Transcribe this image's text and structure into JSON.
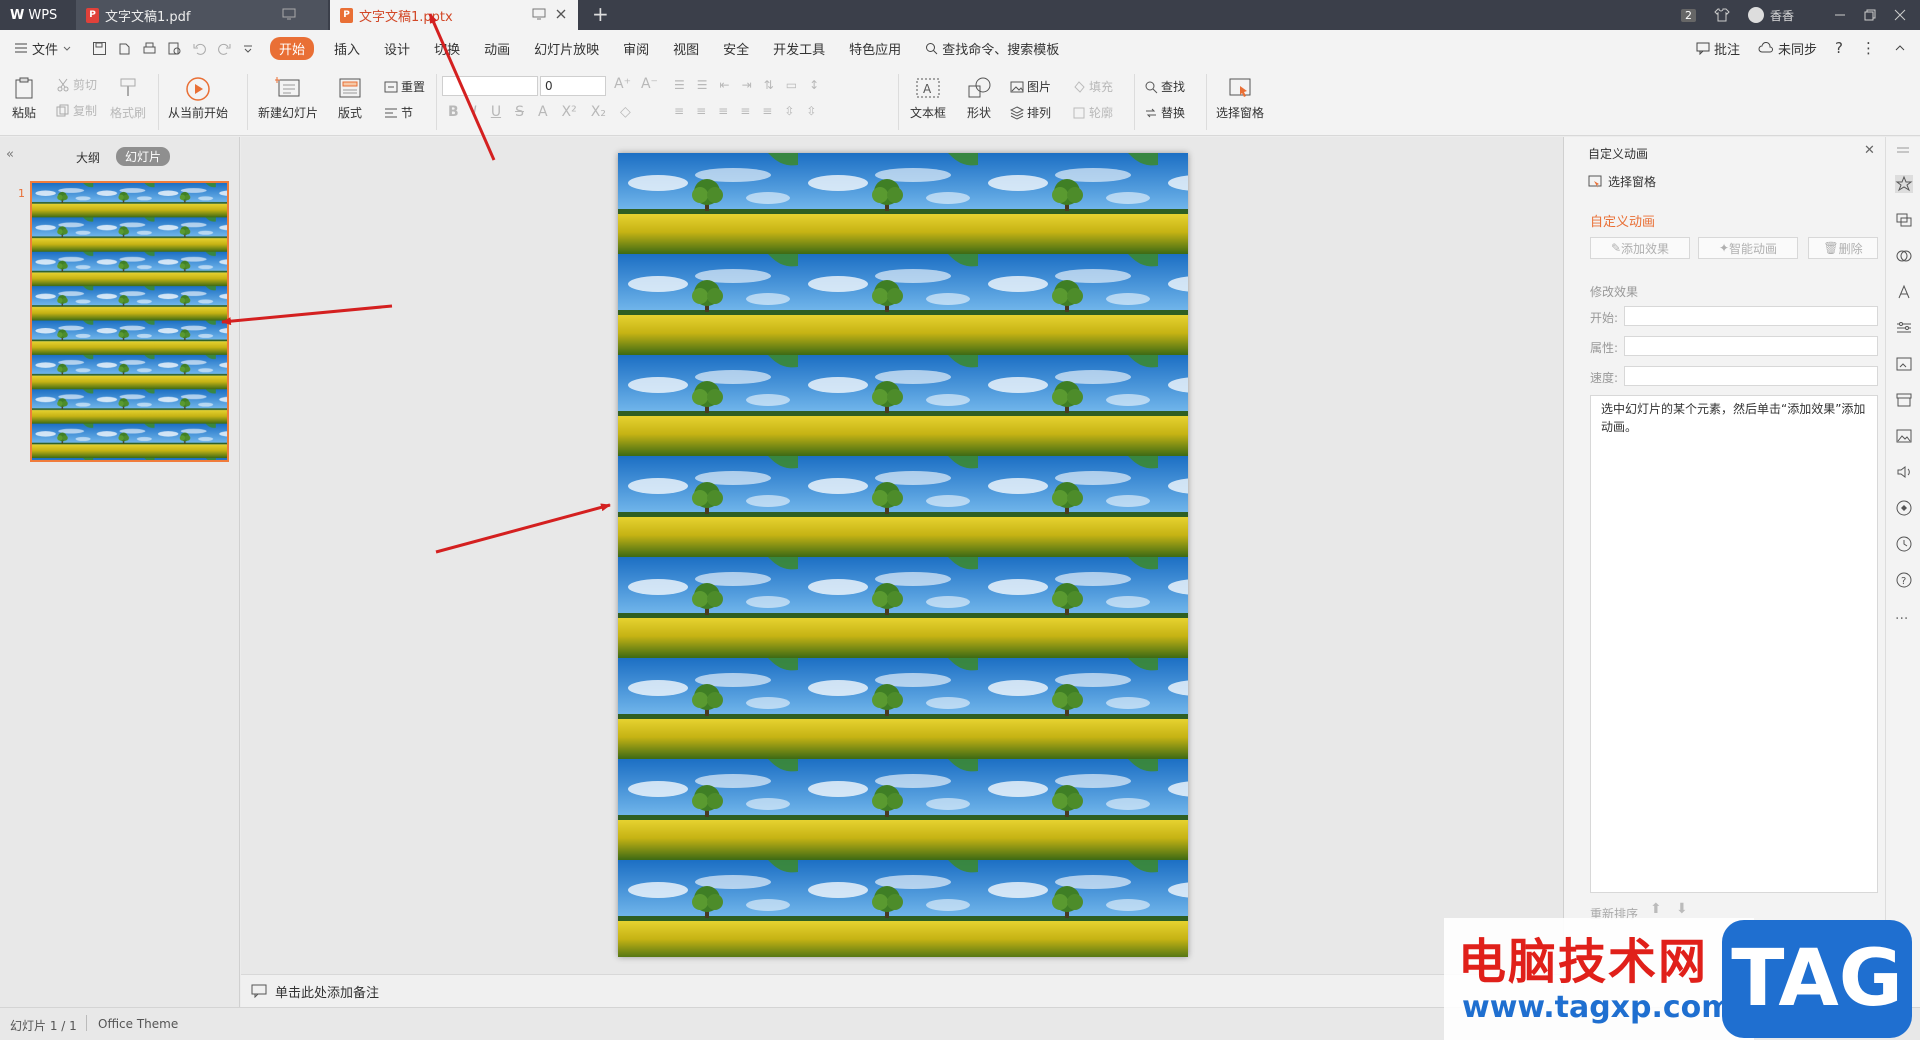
{
  "titlebar": {
    "app_label": "WPS",
    "tabs": [
      {
        "label": "文字文稿1.pdf",
        "icon": "pdf-file-icon"
      },
      {
        "label": "文字文稿1.pptx",
        "icon": "pptx-file-icon",
        "active": true
      }
    ],
    "page_count_badge": "2",
    "user_name": "香香"
  },
  "menubar": {
    "file_label": "文件",
    "items": [
      "开始",
      "插入",
      "设计",
      "切换",
      "动画",
      "幻灯片放映",
      "审阅",
      "视图",
      "安全",
      "开发工具",
      "特色应用"
    ],
    "active_item": "开始",
    "search_label": "查找命令、搜索模板",
    "comment_label": "批注",
    "sync_label": "未同步"
  },
  "ribbon": {
    "paste": "粘贴",
    "cut": "剪切",
    "copy": "复制",
    "format_painter": "格式刷",
    "play_from_current": "从当前开始",
    "new_slide": "新建幻灯片",
    "layout": "版式",
    "reset": "重置",
    "section": "节",
    "font_size_value": "0",
    "textbox": "文本框",
    "shape": "形状",
    "picture": "图片",
    "fill": "填充",
    "arrange": "排列",
    "outline": "轮廓",
    "find": "查找",
    "replace": "替换",
    "selection_pane": "选择窗格"
  },
  "left_panel": {
    "tab_outline": "大纲",
    "tab_slides": "幻灯片",
    "slide_number": "1"
  },
  "notes_placeholder": "单击此处添加备注",
  "right_panel": {
    "title": "自定义动画",
    "selection_pane": "选择窗格",
    "section_title": "自定义动画",
    "add_effect": "添加效果",
    "smart_animation": "智能动画",
    "delete": "删除",
    "modify_effect": "修改效果",
    "start_label": "开始:",
    "property_label": "属性:",
    "speed_label": "速度:",
    "hint": "选中幻灯片的某个元素，然后单击“添加效果”添加动画。",
    "reorder": "重新排序"
  },
  "statusbar": {
    "slide_info": "幻灯片 1 / 1",
    "theme": "Office Theme"
  },
  "watermark": {
    "site_name": "电脑技术网",
    "url": "www.tagxp.com",
    "logo_text": "TAG"
  },
  "colors": {
    "accent_orange": "#e96f35",
    "titlebar_bg": "#3b3f4a",
    "annotation_arrow": "#d42020",
    "watermark_red": "#e0201a",
    "watermark_blue": "#1f6fd0"
  }
}
